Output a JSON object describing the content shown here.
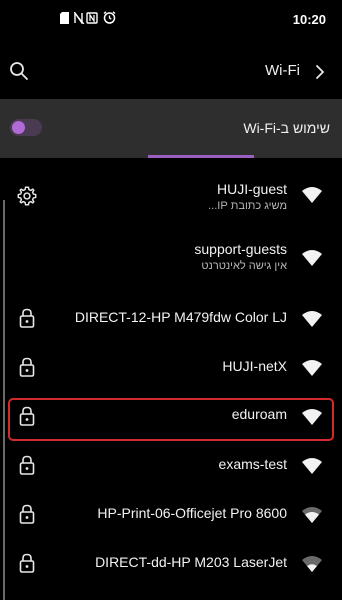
{
  "status_bar": {
    "time": "10:20",
    "icons": [
      "sim-icon",
      "nfc-icon",
      "alarm-icon"
    ]
  },
  "top_bar": {
    "title": "Wi-Fi",
    "search_icon": "search-icon",
    "chevron_icon": "chevron-right-icon"
  },
  "wifi_toggle": {
    "label": "שימוש ב-Wi-Fi",
    "enabled": true
  },
  "networks": [
    {
      "name": "HUJI-guest",
      "subtitle": "משיג כתובת IP...",
      "left_icon": "gear-icon",
      "signal": "full"
    },
    {
      "name": "support-guests",
      "subtitle": "אין גישה לאינטרנט",
      "left_icon": "",
      "signal": "full"
    },
    {
      "name": "DIRECT-12-HP M479fdw Color LJ",
      "subtitle": "",
      "left_icon": "lock-icon",
      "signal": "full"
    },
    {
      "name": "HUJI-netX",
      "subtitle": "",
      "left_icon": "lock-icon",
      "signal": "full"
    },
    {
      "name": "eduroam",
      "subtitle": "",
      "left_icon": "lock-icon",
      "signal": "full"
    },
    {
      "name": "exams-test",
      "subtitle": "",
      "left_icon": "lock-icon",
      "signal": "full"
    },
    {
      "name": "HP-Print-06-Officejet Pro 8600",
      "subtitle": "",
      "left_icon": "lock-icon",
      "signal": "medium"
    },
    {
      "name": "DIRECT-dd-HP M203 LaserJet",
      "subtitle": "",
      "left_icon": "lock-icon",
      "signal": "low"
    }
  ],
  "colors": {
    "accent": "#9b5fc0",
    "highlight": "#d42a2a",
    "toggle_bg": "#2e2e2e"
  }
}
